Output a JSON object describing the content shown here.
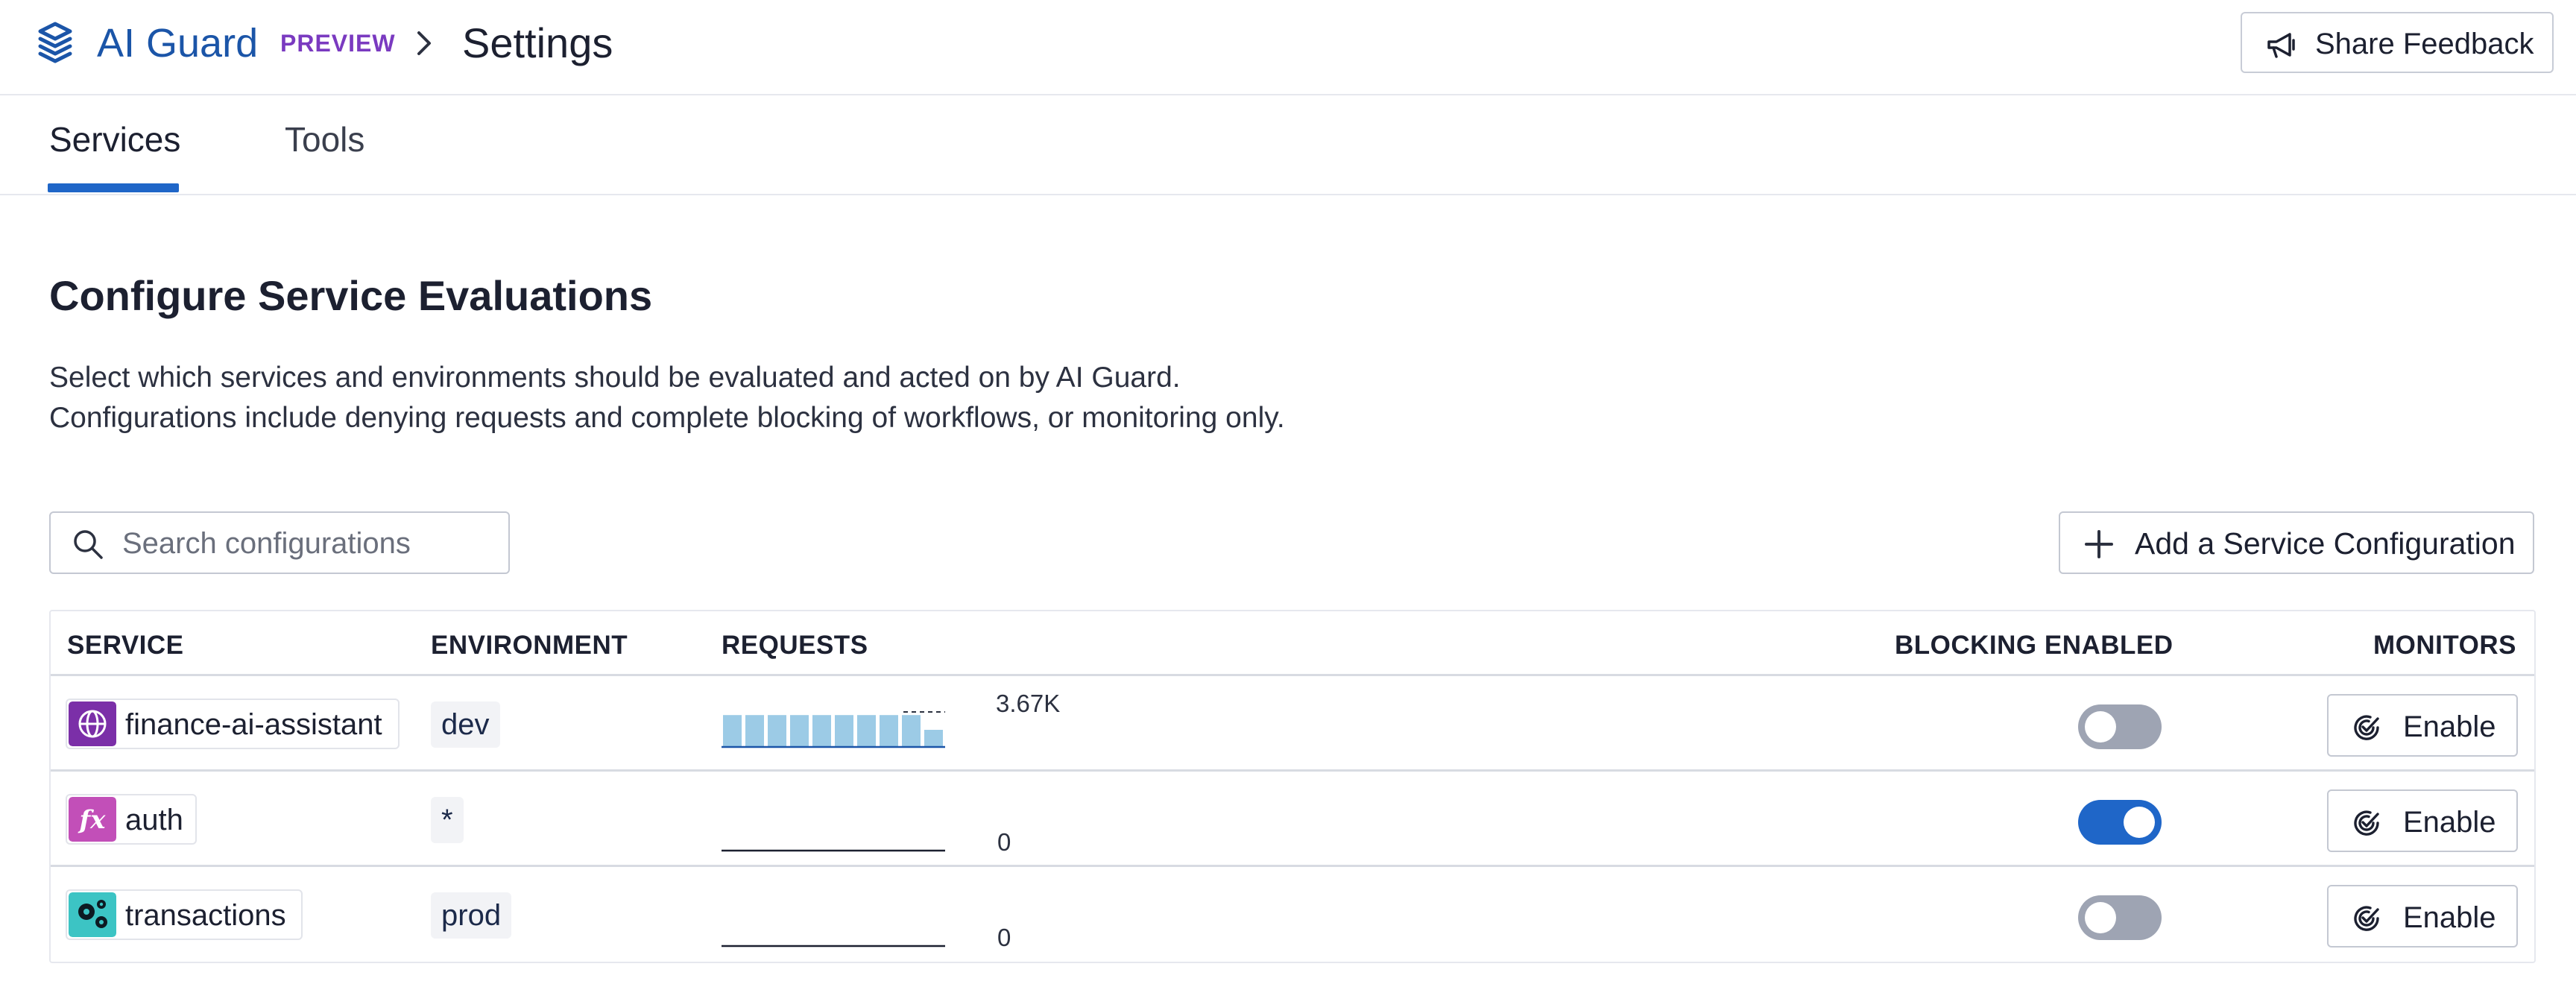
{
  "header": {
    "brand": "AI Guard",
    "badge": "PREVIEW",
    "title": "Settings",
    "feedback_label": "Share Feedback"
  },
  "tabs": [
    {
      "label": "Services",
      "active": true
    },
    {
      "label": "Tools",
      "active": false
    }
  ],
  "main": {
    "title": "Configure Service Evaluations",
    "description": [
      "Select which services and environments should be evaluated and acted on by AI Guard.",
      "Configurations include denying requests and complete blocking of workflows, or monitoring only."
    ],
    "search_placeholder": "Search configurations",
    "add_label": "Add a Service Configuration"
  },
  "table": {
    "columns": [
      "SERVICE",
      "ENVIRONMENT",
      "REQUESTS",
      "BLOCKING ENABLED",
      "MONITORS"
    ],
    "rows": [
      {
        "service": "finance-ai-assistant",
        "icon": "globe-icon",
        "icon_color": "#7b2fa8",
        "environment": "dev",
        "requests_label": "3.67K",
        "requests_bars": [
          0.95,
          0.95,
          0.95,
          0.95,
          0.95,
          0.95,
          0.95,
          0.95,
          0.95,
          0.5
        ],
        "blocking_enabled": false,
        "monitor_label": "Enable"
      },
      {
        "service": "auth",
        "icon": "function-icon",
        "icon_color": "#c24fb8",
        "environment": "*",
        "requests_label": "0",
        "requests_bars": [],
        "blocking_enabled": true,
        "monitor_label": "Enable"
      },
      {
        "service": "transactions",
        "icon": "gears-icon",
        "icon_color": "#3cc4c4",
        "environment": "prod",
        "requests_label": "0",
        "requests_bars": [],
        "blocking_enabled": false,
        "monitor_label": "Enable"
      }
    ]
  },
  "colors": {
    "accent": "#1f66c8",
    "brand": "#1b55a8",
    "preview": "#7a3ac0",
    "bar": "#9ccbe6"
  }
}
